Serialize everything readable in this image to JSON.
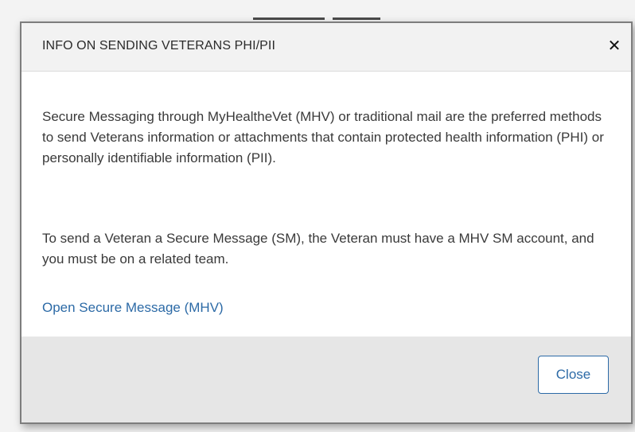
{
  "dialog": {
    "title": "INFO ON SENDING VETERANS PHI/PII",
    "close_icon": "close-icon",
    "paragraphs": [
      "Secure Messaging through MyHealtheVet (MHV) or traditional mail are the preferred methods to send Veterans information or attachments that contain protected health information (PHI) or personally identifiable information (PII).",
      "To send a Veteran a Secure Message (SM), the Veteran must have a MHV SM account, and you must be on a related team."
    ],
    "link_label": "Open Secure Message (MHV)",
    "close_button_label": "Close"
  },
  "colors": {
    "accent": "#2c6aa6",
    "header_bg": "#f2f2f2",
    "footer_bg": "#e6e6e6",
    "text": "#3a3a3a"
  }
}
